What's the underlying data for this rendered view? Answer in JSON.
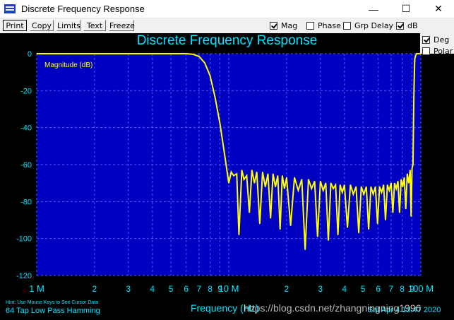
{
  "window": {
    "title": "Discrete Frequency Response",
    "minimize_glyph": "—",
    "maximize_glyph": "☐",
    "close_glyph": "✕",
    "icon": "app-icon"
  },
  "toolbar": {
    "buttons": [
      "Print",
      "Copy",
      "Limits",
      "Text",
      "Freeze"
    ],
    "checkboxes": [
      {
        "label": "Mag",
        "checked": true
      },
      {
        "label": "Phase",
        "checked": false
      },
      {
        "label": "Grp Delay",
        "checked": false
      },
      {
        "label": "dB",
        "checked": true
      },
      {
        "label": "Deg",
        "checked": true
      },
      {
        "label": "Polar",
        "checked": false
      }
    ]
  },
  "footer": {
    "hint": "Hint: Use Mouse Keys to See Cursor Data",
    "filter_desc": "64 Tap Low Pass Hamming",
    "date": "Sat Apr 4 13:47 2020",
    "watermark": "https://blog.csdn.net/zhangningning1996"
  },
  "colors": {
    "background": "#000000",
    "plot_bg": "#0000c0",
    "grid": "#4a5bff",
    "text": "#00e5ff",
    "trace": "#ffff00"
  },
  "chart_data": {
    "type": "line",
    "title": "Discrete Frequency Response",
    "legend": "Magnitude (dB)",
    "legend_placement": "top-left",
    "xlabel": "Frequency (Hz)",
    "ylabel": "",
    "x_scale": "log",
    "xlim": [
      1000000,
      100000000
    ],
    "ylim": [
      -120,
      0
    ],
    "grid": true,
    "y_ticks": [
      0,
      -20,
      -40,
      -60,
      -80,
      -100,
      -120
    ],
    "x_tick_labels": [
      {
        "value": 1000000,
        "label": "1 M"
      },
      {
        "value": 2000000,
        "label": "2"
      },
      {
        "value": 3000000,
        "label": "3"
      },
      {
        "value": 4000000,
        "label": "4"
      },
      {
        "value": 5000000,
        "label": "5"
      },
      {
        "value": 6000000,
        "label": "6"
      },
      {
        "value": 7000000,
        "label": "7"
      },
      {
        "value": 8000000,
        "label": "8"
      },
      {
        "value": 9000000,
        "label": "9"
      },
      {
        "value": 10000000,
        "label": "10 M"
      },
      {
        "value": 20000000,
        "label": "2"
      },
      {
        "value": 30000000,
        "label": "3"
      },
      {
        "value": 40000000,
        "label": "4"
      },
      {
        "value": 50000000,
        "label": "5"
      },
      {
        "value": 60000000,
        "label": "6"
      },
      {
        "value": 70000000,
        "label": "7"
      },
      {
        "value": 80000000,
        "label": "8"
      },
      {
        "value": 90000000,
        "label": "9"
      },
      {
        "value": 100000000,
        "label": "100 M"
      }
    ],
    "series": [
      {
        "name": "Magnitude (dB)",
        "x": [
          1000000,
          2000000,
          3000000,
          4000000,
          5000000,
          6000000,
          6500000,
          7000000,
          7500000,
          8000000,
          8500000,
          9000000,
          9500000,
          10000000,
          10300000,
          10600000,
          11000000,
          11300000,
          11700000,
          12000000,
          12400000,
          12800000,
          13200000,
          13600000,
          14000000,
          14500000,
          15000000,
          15500000,
          16000000,
          16500000,
          17000000,
          17500000,
          18000000,
          18500000,
          19000000,
          19500000,
          20000000,
          21000000,
          22000000,
          23000000,
          24000000,
          25000000,
          26000000,
          27000000,
          28000000,
          29000000,
          30000000,
          31000000,
          32000000,
          33000000,
          34000000,
          35000000,
          36000000,
          37000000,
          38000000,
          39000000,
          40000000,
          41500000,
          43000000,
          44500000,
          46000000,
          47500000,
          49000000,
          50500000,
          52000000,
          53500000,
          55000000,
          56500000,
          58000000,
          59500000,
          61000000,
          62500000,
          64000000,
          65500000,
          67000000,
          68500000,
          70000000,
          71500000,
          73000000,
          74500000,
          76000000,
          77500000,
          79000000,
          80500000,
          82000000,
          83500000,
          85000000,
          86500000,
          88000000,
          89000000,
          90000000,
          91000000,
          92000000,
          93000000,
          94000000,
          95000000,
          96000000,
          100000000
        ],
        "values": [
          0,
          0,
          0,
          0,
          0,
          0,
          -0.3,
          -1.5,
          -5,
          -12,
          -24,
          -38,
          -54,
          -70,
          -64,
          -66,
          -65,
          -98,
          -63,
          -68,
          -66,
          -86,
          -63,
          -70,
          -64,
          -92,
          -64,
          -72,
          -65,
          -89,
          -65,
          -72,
          -66,
          -95,
          -66,
          -73,
          -67,
          -93,
          -67,
          -74,
          -68,
          -106,
          -68,
          -73,
          -69,
          -99,
          -69,
          -74,
          -70,
          -101,
          -70,
          -73,
          -71,
          -98,
          -71,
          -75,
          -71,
          -94,
          -71,
          -76,
          -72,
          -97,
          -72,
          -76,
          -72,
          -95,
          -72,
          -76,
          -72,
          -92,
          -72,
          -75,
          -71,
          -90,
          -71,
          -74,
          -70,
          -86,
          -70,
          -73,
          -69,
          -86,
          -68,
          -72,
          -67,
          -84,
          -65,
          -70,
          -63,
          -88,
          -62,
          -60,
          -22,
          -3,
          -1,
          0,
          0,
          0
        ]
      }
    ]
  }
}
